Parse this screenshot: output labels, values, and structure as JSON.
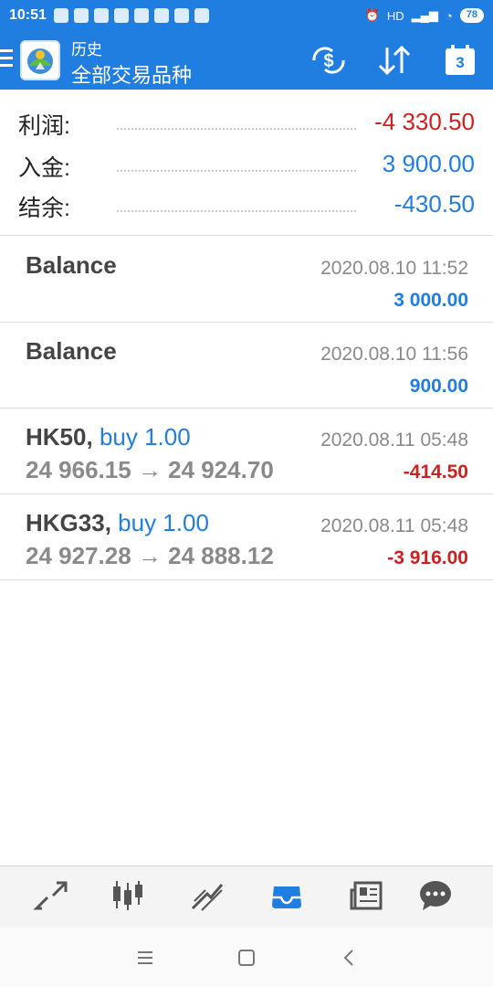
{
  "status_bar": {
    "time": "10:51",
    "battery": "78",
    "signal_label": "HD"
  },
  "app_bar": {
    "title": "历史",
    "subtitle": "全部交易品种",
    "calendar_day": "3",
    "icons": [
      "menu-icon",
      "app-logo",
      "dollar-sync-icon",
      "sort-icon",
      "calendar-icon"
    ]
  },
  "summary": {
    "profit_label": "利润:",
    "profit_value": "-4 330.50",
    "deposit_label": "入金:",
    "deposit_value": "3 900.00",
    "balance_label": "结余:",
    "balance_value": "-430.50"
  },
  "deals": [
    {
      "symbol": "Balance",
      "type": "",
      "date": "2020.08.10 11:52",
      "price": "",
      "amount": "3 000.00"
    },
    {
      "symbol": "Balance",
      "type": "",
      "date": "2020.08.10 11:56",
      "price": "",
      "amount": "900.00"
    },
    {
      "symbol": "HK50,",
      "type": "buy 1.00",
      "date": "2020.08.11 05:48",
      "price": "24 966.15 → 24 924.70",
      "amount": "-414.50"
    },
    {
      "symbol": "HKG33,",
      "type": "buy 1.00",
      "date": "2020.08.11 05:48",
      "price": "24 927.28 → 24 888.12",
      "amount": "-3 916.00"
    }
  ],
  "colors": {
    "accent": "#1f7ee0",
    "negative": "#d11f1f",
    "positive": "#1f7ee0",
    "muted": "#8a8a8a"
  },
  "bottom_nav": [
    "quotes-icon",
    "chart-icon",
    "trade-icon",
    "history-icon",
    "news-icon",
    "chat-icon"
  ],
  "system_nav": [
    "recent-apps-icon",
    "home-icon",
    "back-icon"
  ]
}
